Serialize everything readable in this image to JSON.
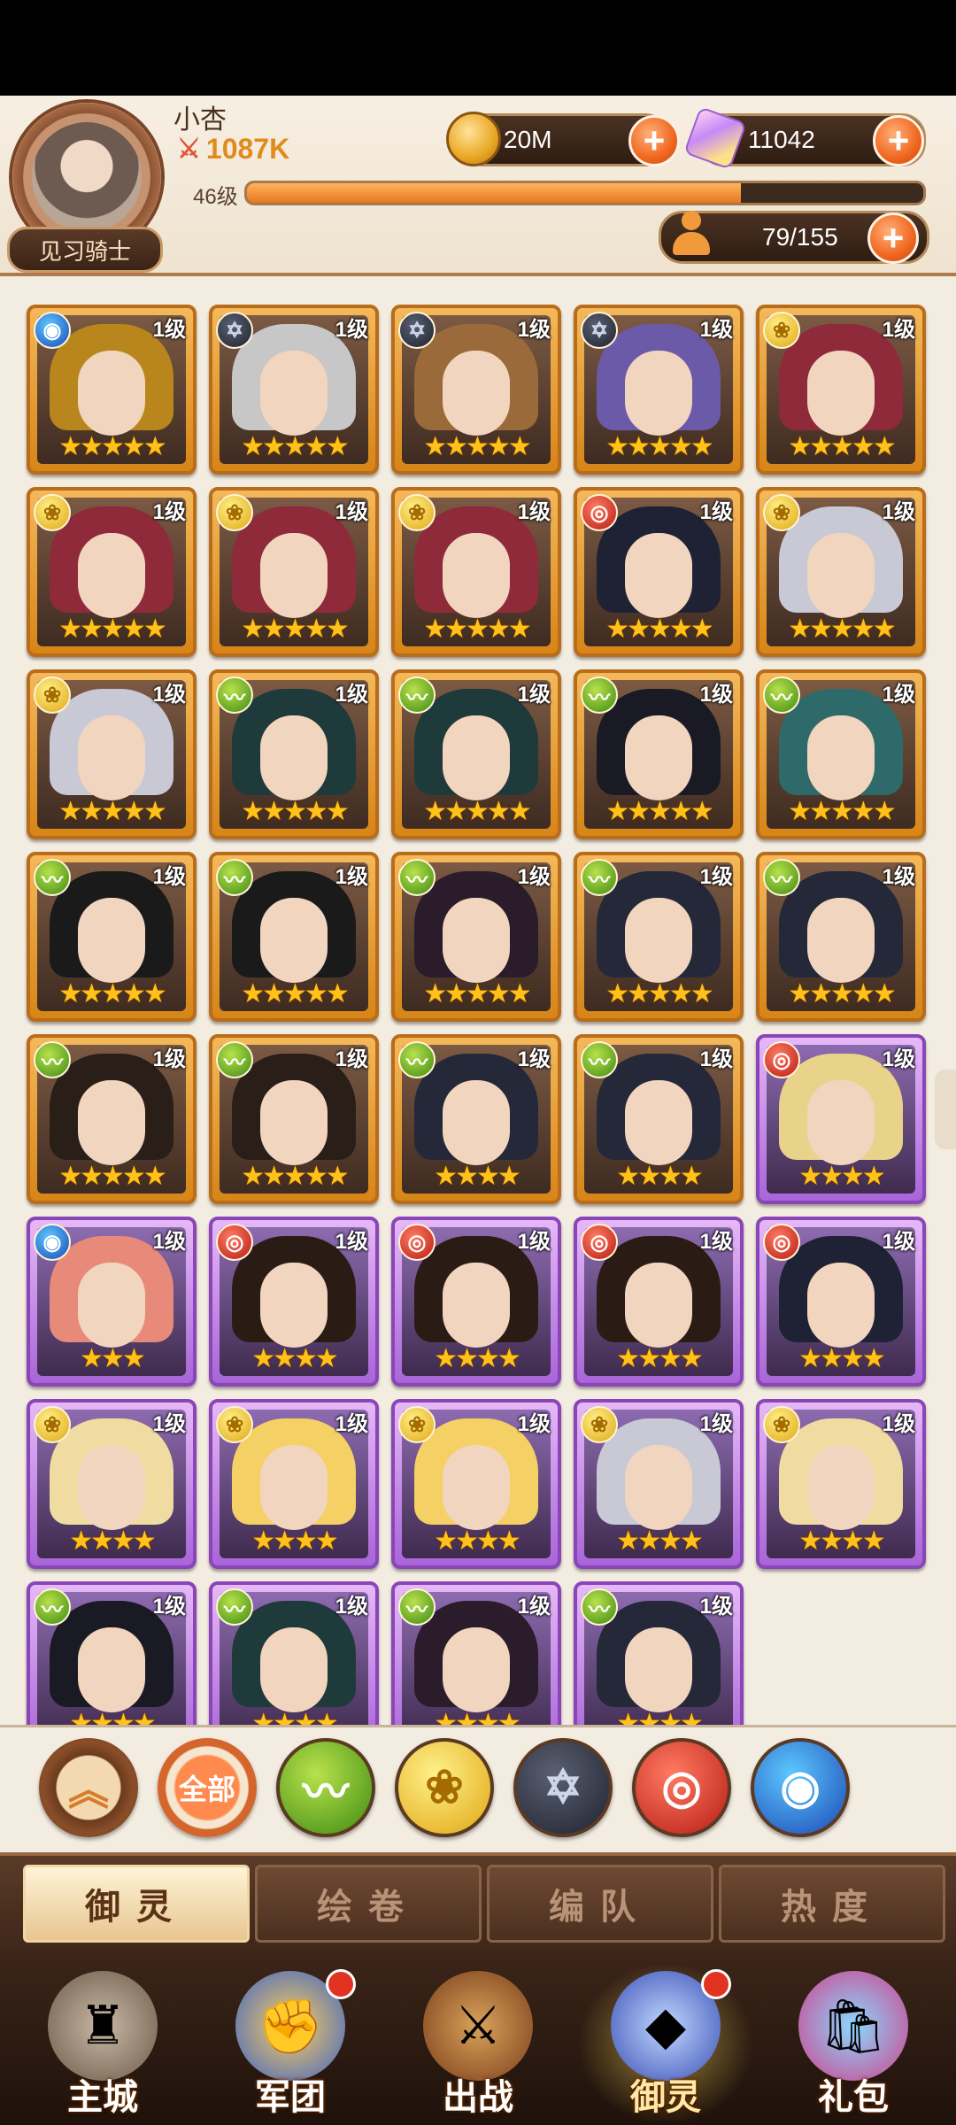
{
  "player": {
    "name": "小杏",
    "power": "1087K",
    "level": "46级",
    "xp_fraction": 0.73,
    "rank": "见习骑士"
  },
  "resources": {
    "gold": "20M",
    "gems": "11042",
    "roster": "79/155"
  },
  "icons": {
    "swords": "crossed-swords-icon",
    "gold": "gold-coin-icon",
    "gem": "gem-icon",
    "person": "person-icon",
    "plus": "plus-icon"
  },
  "factions": {
    "wind": {
      "name": "wind",
      "color": "#3f8a12"
    },
    "rose": {
      "name": "rose",
      "color": "#e0a613"
    },
    "star": {
      "name": "star",
      "color": "#1f2330"
    },
    "fire": {
      "name": "fire",
      "color": "#b71c14"
    },
    "water": {
      "name": "water",
      "color": "#1b48b5"
    }
  },
  "cards": [
    {
      "level": "1级",
      "faction": "water",
      "stars": 5,
      "frame": "orange",
      "hair": "#b8861c"
    },
    {
      "level": "1级",
      "faction": "star",
      "stars": 5,
      "frame": "orange",
      "hair": "#c7c7c7"
    },
    {
      "level": "1级",
      "faction": "star",
      "stars": 5,
      "frame": "orange",
      "hair": "#9a6a3a"
    },
    {
      "level": "1级",
      "faction": "star",
      "stars": 5,
      "frame": "orange",
      "hair": "#6b5aa8"
    },
    {
      "level": "1级",
      "faction": "rose",
      "stars": 5,
      "frame": "orange",
      "hair": "#8e2a3a"
    },
    {
      "level": "1级",
      "faction": "rose",
      "stars": 5,
      "frame": "orange",
      "hair": "#8e2a3a"
    },
    {
      "level": "1级",
      "faction": "rose",
      "stars": 5,
      "frame": "orange",
      "hair": "#8e2a3a"
    },
    {
      "level": "1级",
      "faction": "rose",
      "stars": 5,
      "frame": "orange",
      "hair": "#8e2a3a"
    },
    {
      "level": "1级",
      "faction": "fire",
      "stars": 5,
      "frame": "orange",
      "hair": "#1e2234"
    },
    {
      "level": "1级",
      "faction": "rose",
      "stars": 5,
      "frame": "orange",
      "hair": "#c9c9d6"
    },
    {
      "level": "1级",
      "faction": "rose",
      "stars": 5,
      "frame": "orange",
      "hair": "#c9c9d6"
    },
    {
      "level": "1级",
      "faction": "wind",
      "stars": 5,
      "frame": "orange",
      "hair": "#1f3a3a"
    },
    {
      "level": "1级",
      "faction": "wind",
      "stars": 5,
      "frame": "orange",
      "hair": "#1f3a3a"
    },
    {
      "level": "1级",
      "faction": "wind",
      "stars": 5,
      "frame": "orange",
      "hair": "#1a1a24"
    },
    {
      "level": "1级",
      "faction": "wind",
      "stars": 5,
      "frame": "orange",
      "hair": "#2e6a6a"
    },
    {
      "level": "1级",
      "faction": "wind",
      "stars": 5,
      "frame": "orange",
      "hair": "#1a1a1a"
    },
    {
      "level": "1级",
      "faction": "wind",
      "stars": 5,
      "frame": "orange",
      "hair": "#1a1a1a"
    },
    {
      "level": "1级",
      "faction": "wind",
      "stars": 5,
      "frame": "orange",
      "hair": "#2a1c2a"
    },
    {
      "level": "1级",
      "faction": "wind",
      "stars": 5,
      "frame": "orange",
      "hair": "#242838"
    },
    {
      "level": "1级",
      "faction": "wind",
      "stars": 5,
      "frame": "orange",
      "hair": "#242838"
    },
    {
      "level": "1级",
      "faction": "wind",
      "stars": 5,
      "frame": "orange",
      "hair": "#2a1e18"
    },
    {
      "level": "1级",
      "faction": "wind",
      "stars": 5,
      "frame": "orange",
      "hair": "#2a1e18"
    },
    {
      "level": "1级",
      "faction": "wind",
      "stars": 4,
      "frame": "orange",
      "hair": "#242838"
    },
    {
      "level": "1级",
      "faction": "wind",
      "stars": 4,
      "frame": "orange",
      "hair": "#242838"
    },
    {
      "level": "1级",
      "faction": "fire",
      "stars": 4,
      "frame": "purple",
      "hair": "#e9d38a"
    },
    {
      "level": "1级",
      "faction": "water",
      "stars": 3,
      "frame": "purple",
      "hair": "#e88a7a"
    },
    {
      "level": "1级",
      "faction": "fire",
      "stars": 4,
      "frame": "purple",
      "hair": "#2a1c14"
    },
    {
      "level": "1级",
      "faction": "fire",
      "stars": 4,
      "frame": "purple",
      "hair": "#2a1c14"
    },
    {
      "level": "1级",
      "faction": "fire",
      "stars": 4,
      "frame": "purple",
      "hair": "#2a1c14"
    },
    {
      "level": "1级",
      "faction": "fire",
      "stars": 4,
      "frame": "purple",
      "hair": "#1e2234"
    },
    {
      "level": "1级",
      "faction": "rose",
      "stars": 4,
      "frame": "purple",
      "hair": "#f0dca0"
    },
    {
      "level": "1级",
      "faction": "rose",
      "stars": 4,
      "frame": "purple",
      "hair": "#f5d064"
    },
    {
      "level": "1级",
      "faction": "rose",
      "stars": 4,
      "frame": "purple",
      "hair": "#f5d064"
    },
    {
      "level": "1级",
      "faction": "rose",
      "stars": 4,
      "frame": "purple",
      "hair": "#c9c9d6"
    },
    {
      "level": "1级",
      "faction": "rose",
      "stars": 4,
      "frame": "purple",
      "hair": "#f0dca0"
    },
    {
      "level": "1级",
      "faction": "wind",
      "stars": 4,
      "frame": "purple",
      "hair": "#1a1a24"
    },
    {
      "level": "1级",
      "faction": "wind",
      "stars": 4,
      "frame": "purple",
      "hair": "#1f3a3a"
    },
    {
      "level": "1级",
      "faction": "wind",
      "stars": 4,
      "frame": "purple",
      "hair": "#2a1c2a"
    },
    {
      "level": "1级",
      "faction": "wind",
      "stars": 4,
      "frame": "purple",
      "hair": "#242838"
    }
  ],
  "filters": [
    {
      "id": "collapse",
      "label": "︽",
      "icon": "double-chevron-up-icon"
    },
    {
      "id": "all",
      "label": "全部",
      "icon": "all-filter-icon"
    },
    {
      "id": "wind",
      "label": "",
      "icon": "wind-faction-icon"
    },
    {
      "id": "rose",
      "label": "",
      "icon": "rose-faction-icon"
    },
    {
      "id": "star",
      "label": "",
      "icon": "star-faction-icon"
    },
    {
      "id": "fire",
      "label": "",
      "icon": "fire-faction-icon"
    },
    {
      "id": "water",
      "label": "",
      "icon": "water-faction-icon"
    }
  ],
  "tabs": [
    "御灵",
    "绘卷",
    "编队",
    "热度"
  ],
  "nav": [
    {
      "label": "主城",
      "icon": "castle-icon",
      "badge": false
    },
    {
      "label": "军团",
      "icon": "legion-fist-icon",
      "badge": true
    },
    {
      "label": "出战",
      "icon": "battle-sword-icon",
      "badge": false
    },
    {
      "label": "御灵",
      "icon": "crystal-icon",
      "badge": true,
      "active": true
    },
    {
      "label": "礼包",
      "icon": "gift-shop-icon",
      "badge": false
    }
  ]
}
